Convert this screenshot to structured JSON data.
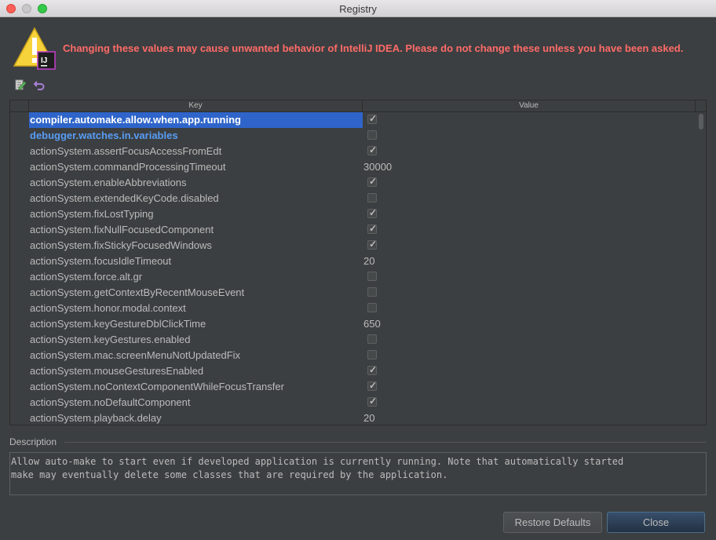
{
  "window": {
    "title": "Registry"
  },
  "warning": {
    "text": "Changing these values may cause unwanted behavior of IntelliJ IDEA. Please do not change these unless you have been asked."
  },
  "toolbar": {
    "edit_icon": "edit-icon",
    "revert_icon": "revert-icon"
  },
  "table": {
    "columns": [
      "Key",
      "Value"
    ],
    "rows": [
      {
        "key": "compiler.automake.allow.when.app.running",
        "type": "bool",
        "value": true,
        "state": "selected"
      },
      {
        "key": "debugger.watches.in.variables",
        "type": "bool",
        "value": false,
        "state": "modified"
      },
      {
        "key": "actionSystem.assertFocusAccessFromEdt",
        "type": "bool",
        "value": true,
        "state": ""
      },
      {
        "key": "actionSystem.commandProcessingTimeout",
        "type": "text",
        "value": "30000",
        "state": ""
      },
      {
        "key": "actionSystem.enableAbbreviations",
        "type": "bool",
        "value": true,
        "state": ""
      },
      {
        "key": "actionSystem.extendedKeyCode.disabled",
        "type": "bool",
        "value": false,
        "state": ""
      },
      {
        "key": "actionSystem.fixLostTyping",
        "type": "bool",
        "value": true,
        "state": ""
      },
      {
        "key": "actionSystem.fixNullFocusedComponent",
        "type": "bool",
        "value": true,
        "state": ""
      },
      {
        "key": "actionSystem.fixStickyFocusedWindows",
        "type": "bool",
        "value": true,
        "state": ""
      },
      {
        "key": "actionSystem.focusIdleTimeout",
        "type": "text",
        "value": "20",
        "state": ""
      },
      {
        "key": "actionSystem.force.alt.gr",
        "type": "bool",
        "value": false,
        "state": ""
      },
      {
        "key": "actionSystem.getContextByRecentMouseEvent",
        "type": "bool",
        "value": false,
        "state": ""
      },
      {
        "key": "actionSystem.honor.modal.context",
        "type": "bool",
        "value": false,
        "state": ""
      },
      {
        "key": "actionSystem.keyGestureDblClickTime",
        "type": "text",
        "value": "650",
        "state": ""
      },
      {
        "key": "actionSystem.keyGestures.enabled",
        "type": "bool",
        "value": false,
        "state": ""
      },
      {
        "key": "actionSystem.mac.screenMenuNotUpdatedFix",
        "type": "bool",
        "value": false,
        "state": ""
      },
      {
        "key": "actionSystem.mouseGesturesEnabled",
        "type": "bool",
        "value": true,
        "state": ""
      },
      {
        "key": "actionSystem.noContextComponentWhileFocusTransfer",
        "type": "bool",
        "value": true,
        "state": ""
      },
      {
        "key": "actionSystem.noDefaultComponent",
        "type": "bool",
        "value": true,
        "state": ""
      },
      {
        "key": "actionSystem.playback.delay",
        "type": "text",
        "value": "20",
        "state": ""
      }
    ]
  },
  "description": {
    "title": "Description",
    "text": "Allow auto-make to start even if developed application is currently running. Note that automatically started\nmake may eventually delete some classes that are required by the application."
  },
  "buttons": {
    "restore": "Restore Defaults",
    "close": "Close"
  },
  "colors": {
    "selection": "#2f65ca",
    "modified_key": "#589df6",
    "warning": "#ff6b68",
    "background": "#3c3f41"
  }
}
